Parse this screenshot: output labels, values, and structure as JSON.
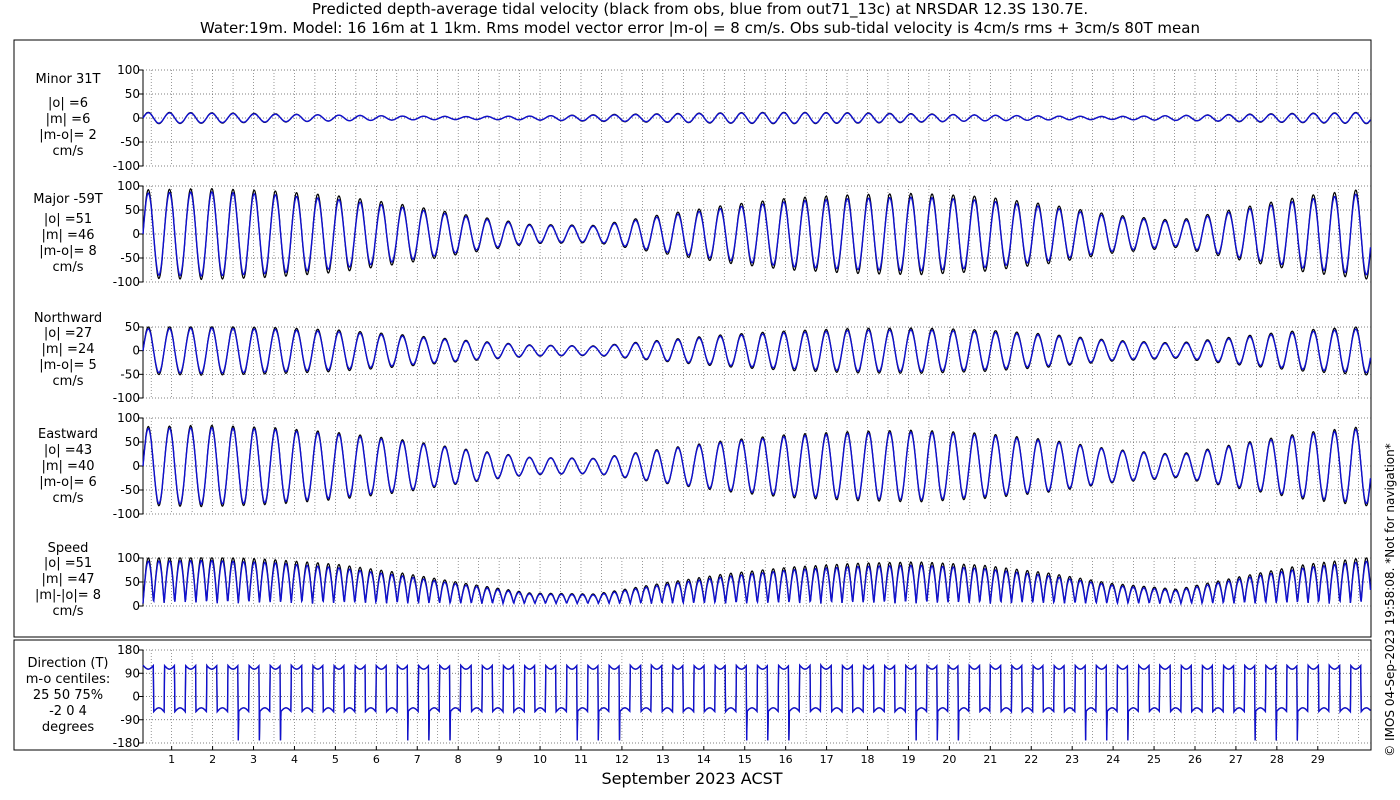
{
  "figure": {
    "title_line1": "Predicted depth-average tidal velocity (black from obs, blue from out71_13c) at NRSDAR 12.3S 130.7E.",
    "title_line2": "Water:19m. Model: 16 16m at 1 1km. Rms model vector error |m-o| = 8 cm/s. Obs sub-tidal velocity is 4cm/s rms + 3cm/s 80T mean",
    "xlabel": "September 2023 ACST",
    "stamp": "© IMOS 04-Sep-2023 19:58:08. *Not for navigation*",
    "colors": {
      "obs": "#000000",
      "model": "#1010d0",
      "grid": "#555555"
    }
  },
  "chart_data": [
    {
      "type": "line",
      "panel": "minor",
      "label_lines": [
        "Minor 31T",
        "|o| =6",
        "|m| =6",
        "|m-o|= 2",
        "cm/s"
      ],
      "ylim": [
        -100,
        100
      ],
      "yticks": [
        -100,
        -50,
        0,
        50,
        100
      ],
      "xlim": [
        0.3,
        30.3
      ],
      "xticks": [
        1,
        2,
        3,
        4,
        5,
        6,
        7,
        8,
        9,
        10,
        11,
        12,
        13,
        14,
        15,
        16,
        17,
        18,
        19,
        20,
        21,
        22,
        23,
        24,
        25,
        26,
        27,
        28,
        29
      ],
      "grid": true,
      "series": [
        {
          "name": "obs",
          "amplitude_envelope": [
            12,
            11,
            9,
            6,
            4,
            3,
            4,
            7,
            9,
            11,
            12,
            11,
            9,
            6,
            4,
            3,
            5,
            8,
            10,
            12
          ]
        },
        {
          "name": "model",
          "amplitude_envelope": [
            11,
            10,
            8,
            6,
            4,
            3,
            4,
            6,
            8,
            10,
            11,
            10,
            8,
            6,
            4,
            3,
            5,
            7,
            9,
            11
          ]
        }
      ]
    },
    {
      "type": "line",
      "panel": "major",
      "label_lines": [
        "Major -59T",
        "|o| =51",
        "|m| =46",
        "|m-o|= 8",
        "cm/s"
      ],
      "ylim": [
        -100,
        100
      ],
      "yticks": [
        -100,
        -50,
        0,
        50,
        100
      ],
      "xlim": [
        0.3,
        30.3
      ],
      "grid": true,
      "series": [
        {
          "name": "obs",
          "amplitude_envelope": [
            92,
            95,
            90,
            80,
            62,
            40,
            20,
            18,
            40,
            60,
            75,
            82,
            85,
            78,
            62,
            40,
            28,
            55,
            80,
            95
          ]
        },
        {
          "name": "model",
          "amplitude_envelope": [
            85,
            88,
            82,
            72,
            56,
            36,
            18,
            16,
            36,
            54,
            68,
            74,
            77,
            70,
            56,
            36,
            25,
            50,
            72,
            86
          ]
        }
      ]
    },
    {
      "type": "line",
      "panel": "northward",
      "label_lines": [
        "Northward",
        "|o| =27",
        "|m| =24",
        "|m-o|= 5",
        "cm/s"
      ],
      "ylim": [
        -100,
        50
      ],
      "yticks": [
        -100,
        -50,
        0,
        50
      ],
      "xlim": [
        0.3,
        30.3
      ],
      "grid": true,
      "series": [
        {
          "name": "obs",
          "amplitude_envelope": [
            50,
            52,
            49,
            44,
            34,
            22,
            12,
            10,
            22,
            34,
            42,
            47,
            48,
            44,
            35,
            22,
            16,
            31,
            44,
            52
          ]
        },
        {
          "name": "model",
          "amplitude_envelope": [
            46,
            48,
            45,
            40,
            31,
            20,
            11,
            9,
            20,
            31,
            38,
            43,
            44,
            40,
            32,
            20,
            14,
            28,
            40,
            47
          ]
        }
      ]
    },
    {
      "type": "line",
      "panel": "eastward",
      "label_lines": [
        "Eastward",
        "|o| =43",
        "|m| =40",
        "|m-o|= 6",
        "cm/s"
      ],
      "ylim": [
        -100,
        100
      ],
      "yticks": [
        -100,
        -50,
        0,
        50,
        100
      ],
      "xlim": [
        0.3,
        30.3
      ],
      "grid": true,
      "series": [
        {
          "name": "obs",
          "amplitude_envelope": [
            82,
            85,
            80,
            70,
            55,
            35,
            18,
            16,
            35,
            53,
            66,
            72,
            75,
            68,
            55,
            35,
            24,
            48,
            70,
            84
          ]
        },
        {
          "name": "model",
          "amplitude_envelope": [
            78,
            80,
            76,
            66,
            52,
            33,
            17,
            15,
            33,
            50,
            62,
            68,
            71,
            64,
            52,
            33,
            22,
            45,
            66,
            79
          ]
        }
      ]
    },
    {
      "type": "line",
      "panel": "speed",
      "label_lines": [
        "Speed",
        "|o| =51",
        "|m| =47",
        "|m|-|o|= 8",
        "cm/s"
      ],
      "ylim": [
        0,
        100
      ],
      "yticks": [
        0,
        50,
        100
      ],
      "xlim": [
        0.3,
        30.3
      ],
      "grid": true,
      "series": [
        {
          "name": "obs",
          "amplitude_envelope": [
            95,
            98,
            92,
            82,
            64,
            42,
            22,
            20,
            42,
            62,
            76,
            84,
            87,
            80,
            64,
            42,
            30,
            57,
            82,
            97
          ]
        },
        {
          "name": "model",
          "amplitude_envelope": [
            88,
            90,
            85,
            75,
            58,
            38,
            20,
            18,
            38,
            56,
            70,
            77,
            80,
            73,
            58,
            38,
            27,
            52,
            75,
            89
          ]
        }
      ]
    },
    {
      "type": "line",
      "panel": "direction",
      "label_lines": [
        "Direction (T)",
        "m-o centiles:",
        "25  50  75%",
        "-2  0  4",
        "degrees"
      ],
      "ylim": [
        -180,
        180
      ],
      "yticks": [
        -180,
        -90,
        0,
        90,
        180
      ],
      "xlim": [
        0.3,
        30.3
      ],
      "grid": true,
      "series": [
        {
          "name": "obs",
          "flood_deg": 121,
          "ebb_deg": -59
        },
        {
          "name": "model",
          "flood_deg": 121,
          "ebb_deg": -59
        }
      ]
    }
  ]
}
